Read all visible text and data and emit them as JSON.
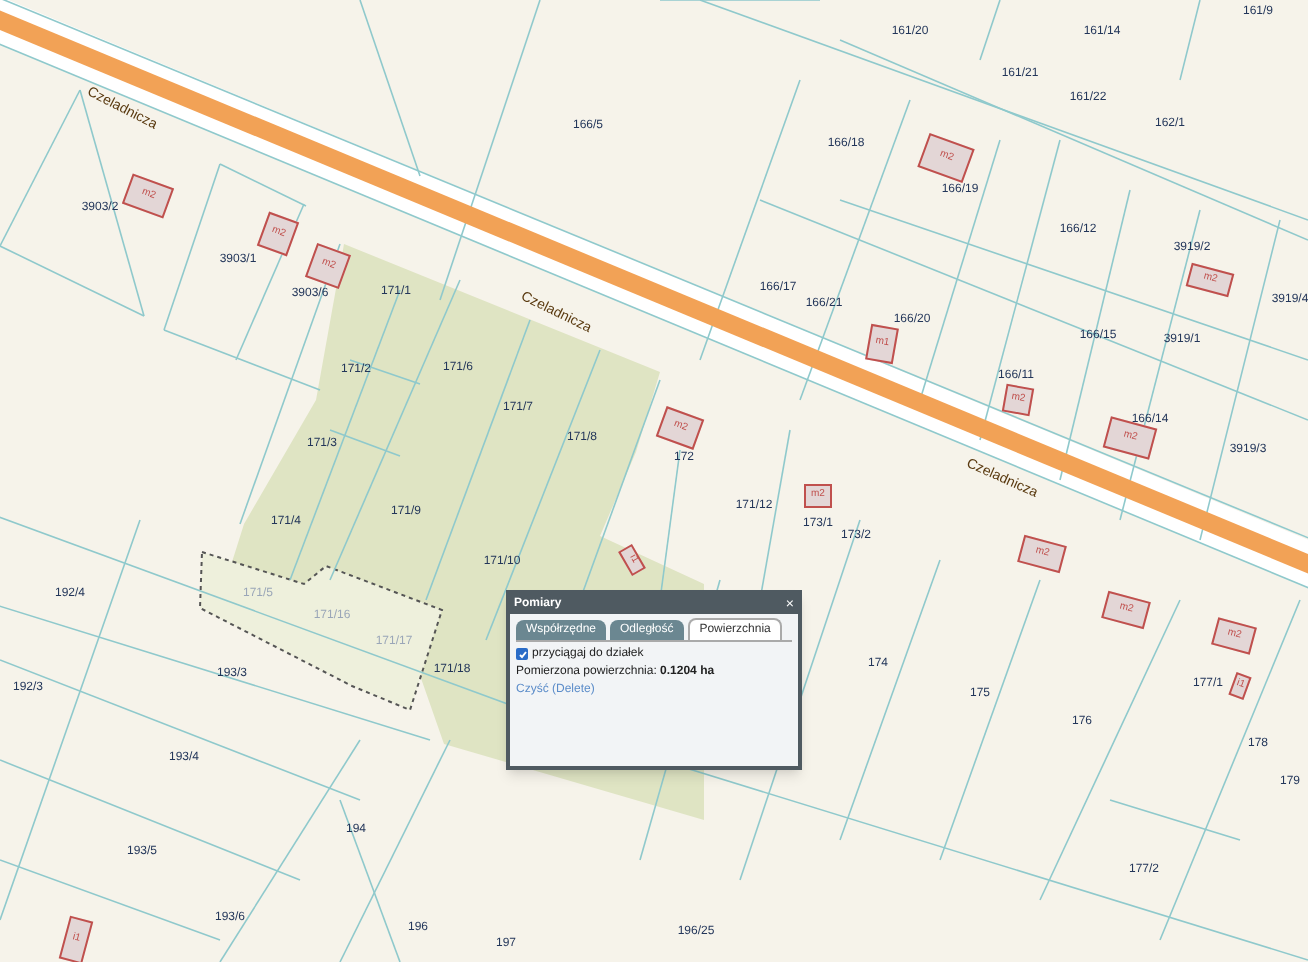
{
  "map": {
    "streets": [
      "Czeladnicza",
      "Czeladnicza",
      "Czeladnicza"
    ],
    "parcels": [
      {
        "number": "166/5",
        "faded": false
      },
      {
        "number": "3903/2",
        "faded": false
      },
      {
        "number": "3903/1",
        "faded": false
      },
      {
        "number": "3903/6",
        "faded": false
      },
      {
        "number": "171/1",
        "faded": false
      },
      {
        "number": "171/2",
        "faded": false
      },
      {
        "number": "171/6",
        "faded": false
      },
      {
        "number": "171/7",
        "faded": false
      },
      {
        "number": "171/8",
        "faded": false
      },
      {
        "number": "171/3",
        "faded": false
      },
      {
        "number": "171/4",
        "faded": false
      },
      {
        "number": "171/9",
        "faded": false
      },
      {
        "number": "171/10",
        "faded": false
      },
      {
        "number": "171/5",
        "faded": true
      },
      {
        "number": "171/16",
        "faded": true
      },
      {
        "number": "171/17",
        "faded": true
      },
      {
        "number": "171/18",
        "faded": false
      },
      {
        "number": "192/4",
        "faded": false
      },
      {
        "number": "192/3",
        "faded": false
      },
      {
        "number": "193/3",
        "faded": false
      },
      {
        "number": "193/4",
        "faded": false
      },
      {
        "number": "193/5",
        "faded": false
      },
      {
        "number": "193/6",
        "faded": false
      },
      {
        "number": "194",
        "faded": false
      },
      {
        "number": "196",
        "faded": false
      },
      {
        "number": "197",
        "faded": false
      },
      {
        "number": "166/18",
        "faded": false
      },
      {
        "number": "166/19",
        "faded": false
      },
      {
        "number": "166/12",
        "faded": false
      },
      {
        "number": "166/17",
        "faded": false
      },
      {
        "number": "166/21",
        "faded": false
      },
      {
        "number": "166/20",
        "faded": false
      },
      {
        "number": "166/15",
        "faded": false
      },
      {
        "number": "166/11",
        "faded": false
      },
      {
        "number": "3919/2",
        "faded": false
      },
      {
        "number": "3919/1",
        "faded": false
      },
      {
        "number": "3919/4",
        "faded": false
      },
      {
        "number": "3919/3",
        "faded": false
      },
      {
        "number": "166/14",
        "faded": false
      },
      {
        "number": "161/20",
        "faded": false
      },
      {
        "number": "161/14",
        "faded": false
      },
      {
        "number": "161/21",
        "faded": false
      },
      {
        "number": "161/22",
        "faded": false
      },
      {
        "number": "162/1",
        "faded": false
      },
      {
        "number": "161/9",
        "faded": false
      },
      {
        "number": "171/12",
        "faded": false
      },
      {
        "number": "173/1",
        "faded": false
      },
      {
        "number": "173/2",
        "faded": false
      },
      {
        "number": "172",
        "faded": false
      },
      {
        "number": "174",
        "faded": false
      },
      {
        "number": "175",
        "faded": false
      },
      {
        "number": "176",
        "faded": false
      },
      {
        "number": "177/1",
        "faded": false
      },
      {
        "number": "178",
        "faded": false
      },
      {
        "number": "179",
        "faded": false
      },
      {
        "number": "177/2",
        "faded": false
      },
      {
        "number": "196/25",
        "faded": false
      }
    ],
    "buildings": [
      {
        "label": "m2"
      },
      {
        "label": "m2"
      },
      {
        "label": "m2"
      },
      {
        "label": "m2"
      },
      {
        "label": "m1"
      },
      {
        "label": "m2"
      },
      {
        "label": "m2"
      },
      {
        "label": "m2"
      },
      {
        "label": "m2"
      },
      {
        "label": "m2"
      },
      {
        "label": "m2"
      },
      {
        "label": "i1"
      },
      {
        "label": "i1"
      },
      {
        "label": "m2"
      },
      {
        "label": "m2"
      },
      {
        "label": "i1"
      }
    ]
  },
  "dialog": {
    "title": "Pomiary",
    "close": "×",
    "tabs": [
      {
        "label": "Współrzędne",
        "selected": false
      },
      {
        "label": "Odległość",
        "selected": false
      },
      {
        "label": "Powierzchnia",
        "selected": true
      }
    ],
    "snap": {
      "label": "przyciągaj do działek",
      "checked": true
    },
    "result": "Pomierzona powierzchnia: **0.1204 ha**",
    "clear_link": "Czyść (Delete)"
  }
}
